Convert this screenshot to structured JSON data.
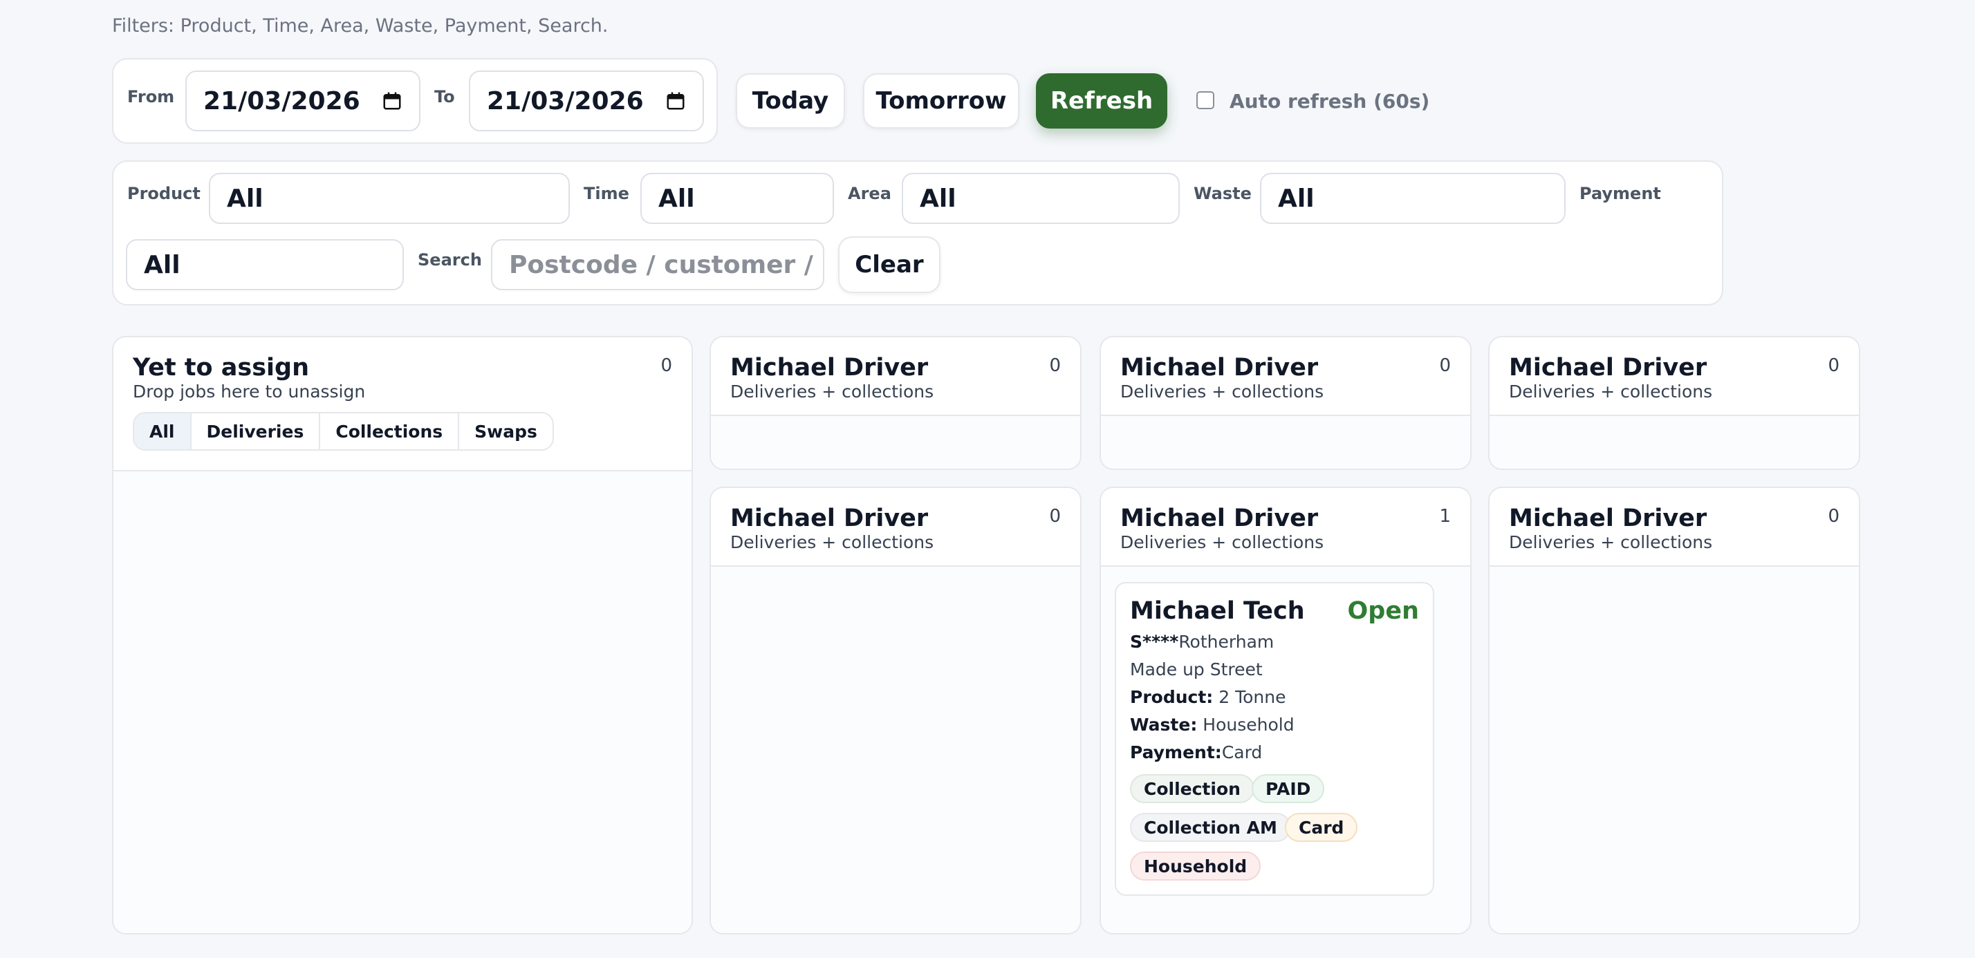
{
  "filters_hint": "Filters: Product, Time, Area, Waste, Payment, Search.",
  "date_range": {
    "from_label": "From",
    "from_value": "21/03/2026",
    "to_label": "To",
    "to_value": "21/03/2026"
  },
  "buttons": {
    "today": "Today",
    "tomorrow": "Tomorrow",
    "refresh": "Refresh",
    "clear": "Clear"
  },
  "auto_refresh_label": "Auto refresh (60s)",
  "filters": {
    "product_label": "Product",
    "product_value": "All",
    "time_label": "Time",
    "time_value": "All",
    "area_label": "Area",
    "area_value": "All",
    "waste_label": "Waste",
    "waste_value": "All",
    "payment_label": "Payment",
    "payment_value": "All",
    "search_label": "Search",
    "search_placeholder": "Postcode / customer / address"
  },
  "unassigned": {
    "title": "Yet to assign",
    "subtitle": "Drop jobs here to unassign",
    "count": "0",
    "tabs": [
      "All",
      "Deliveries",
      "Collections",
      "Swaps"
    ]
  },
  "drivers": [
    {
      "name": "Michael Driver",
      "subtitle": "Deliveries + collections",
      "count": "0"
    },
    {
      "name": "Michael Driver",
      "subtitle": "Deliveries + collections",
      "count": "0"
    },
    {
      "name": "Michael Driver",
      "subtitle": "Deliveries + collections",
      "count": "0"
    },
    {
      "name": "Michael Driver",
      "subtitle": "Deliveries + collections",
      "count": "0"
    },
    {
      "name": "Michael Driver",
      "subtitle": "Deliveries + collections",
      "count": "1"
    },
    {
      "name": "Michael Driver",
      "subtitle": "Deliveries + collections",
      "count": "0"
    }
  ],
  "job_card": {
    "customer": "Michael Tech",
    "status": "Open",
    "postcode_masked": "S****",
    "town": "Rotherham",
    "street": "Made up Street",
    "product_label": "Product:",
    "product_value": "2 Tonne",
    "waste_label": "Waste:",
    "waste_value": "Household",
    "payment_label": "Payment:",
    "payment_value": "Card",
    "tags": [
      "Collection",
      "PAID",
      "Collection AM",
      "Card",
      "Household"
    ]
  },
  "colors": {
    "accent_green": "#2f6b2f",
    "status_open": "#2f7d32"
  }
}
